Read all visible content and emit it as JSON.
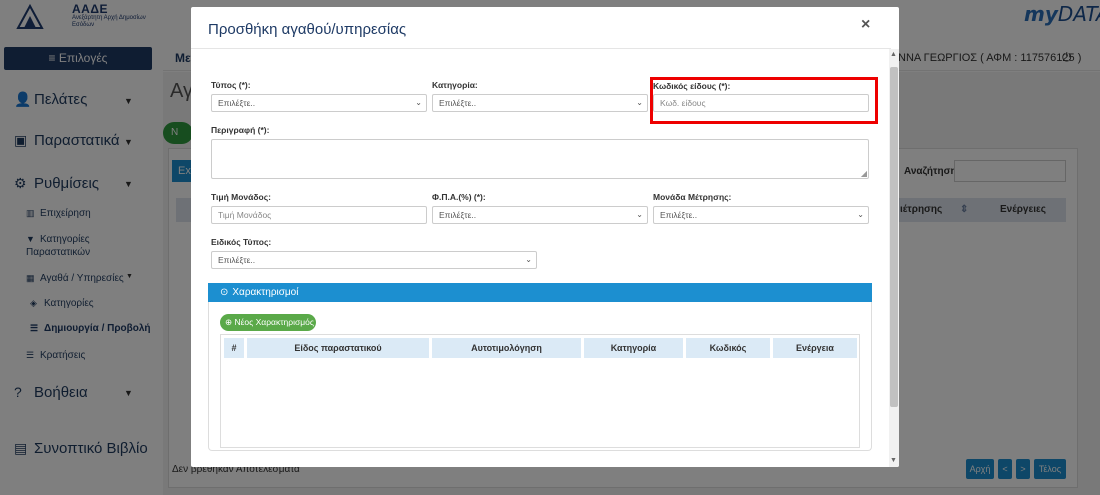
{
  "header": {
    "logo_title": "ΑΑΔΕ",
    "logo_subtitle": "Ανεξάρτητη Αρχή Δημοσίων Εσόδων",
    "app_logo_my": "my",
    "app_logo_data": "DATA",
    "options_label": "Επιλογές",
    "topbar_left": "Μεν",
    "user_label": "ΝΝΑ ΓΕΩΡΓΙΟΣ ( ΑΦΜ : 117576125 )",
    "power_icon": "power-icon"
  },
  "sidebar": {
    "items": [
      {
        "label": "Πελάτες",
        "icon": "user-icon"
      },
      {
        "label": "Παραστατικά",
        "icon": "documents-icon"
      },
      {
        "label": "Ρυθμίσεις",
        "icon": "gear-icon"
      },
      {
        "label": "Βοήθεια",
        "icon": "question-icon"
      },
      {
        "label": "Συνοπτικό Βιβλίο",
        "icon": "book-icon"
      }
    ],
    "sub_items": [
      {
        "label": "Επιχείρηση",
        "icon": "building-icon"
      },
      {
        "label": "Κατηγορίες Παραστατικών",
        "icon": "filter-icon"
      },
      {
        "label": "Αγαθά / Υπηρεσίες",
        "icon": "grid-icon"
      },
      {
        "label": "Κατηγορίες",
        "icon": "layers-icon"
      },
      {
        "label": "Δημιουργία / Προβολή",
        "icon": "list-icon"
      },
      {
        "label": "Κρατήσεις",
        "icon": "list-icon"
      }
    ]
  },
  "background": {
    "heading": "Αγ",
    "green_btn": "Ν",
    "ex_btn": "Ex",
    "search_label": "Αναζήτηση:",
    "col_measure": "ιέτρησης",
    "col_actions": "Ενέργειες",
    "no_results": "Δεν βρέθηκαν Αποτελέσματα",
    "pager": [
      "Αρχή",
      "<",
      ">",
      "Τέλος"
    ]
  },
  "modal": {
    "title": "Προσθήκη αγαθού/υπηρεσίας",
    "close": "×",
    "type_label": "Τύπος (*):",
    "type_value": "Επιλέξτε..",
    "category_label": "Κατηγορία:",
    "category_value": "Επιλέξτε..",
    "code_label": "Κωδικός είδους (*):",
    "code_placeholder": "Κωδ. είδους",
    "description_label": "Περιγραφή (*):",
    "unit_price_label": "Τιμή Μονάδος:",
    "unit_price_placeholder": "Τιμή Μονάδος",
    "vat_label": "Φ.Π.Α.(%) (*):",
    "vat_value": "Επιλέξτε..",
    "measure_label": "Μονάδα Μέτρησης:",
    "measure_value": "Επιλέξτε..",
    "special_type_label": "Ειδικός Τύπος:",
    "special_type_value": "Επιλέξτε..",
    "characterizations_title": "Χαρακτηρισμοί",
    "new_char_button": "Νέος Χαρακτηρισμός",
    "table_columns": [
      "#",
      "Είδος παραστατικού",
      "Αυτοτιμολόγηση",
      "Κατηγορία",
      "Κωδικός",
      "Ενέργεια"
    ]
  },
  "colors": {
    "accent": "#1c8fd0",
    "highlight": "#e00000",
    "navy": "#1e3a65"
  }
}
